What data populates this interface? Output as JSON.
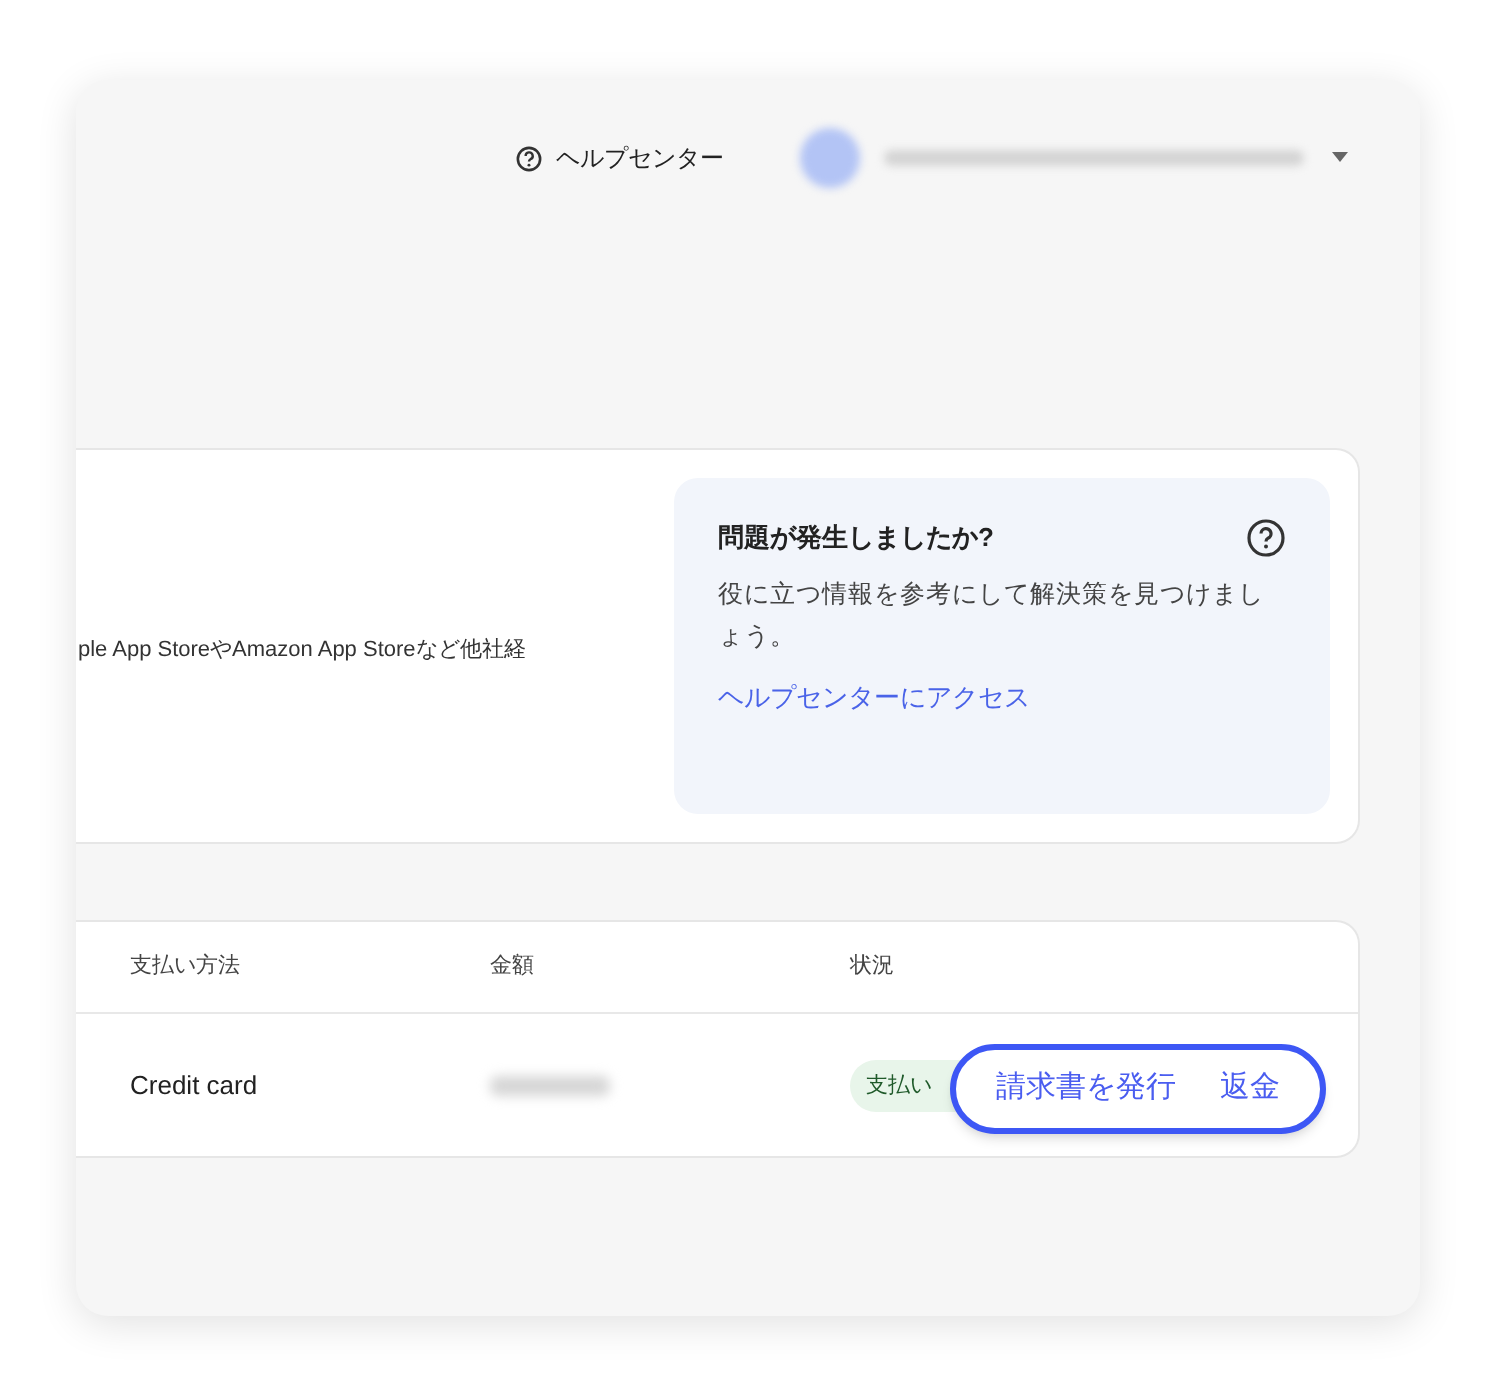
{
  "header": {
    "help_link": "ヘルプセンター"
  },
  "summary": {
    "description": "ple App StoreやAmazon App Storeなど他社経"
  },
  "help_panel": {
    "title": "問題が発生しましたか?",
    "body": "役に立つ情報を参考にして解決策を見つけましょう。",
    "link": "ヘルプセンターにアクセス"
  },
  "table": {
    "columns": [
      "支払い方法",
      "金額",
      "状況"
    ],
    "rows": [
      {
        "payment_method": "Credit card",
        "status": "支払い"
      }
    ]
  },
  "action_menu": {
    "items": [
      "請求書を発行",
      "返金"
    ]
  }
}
